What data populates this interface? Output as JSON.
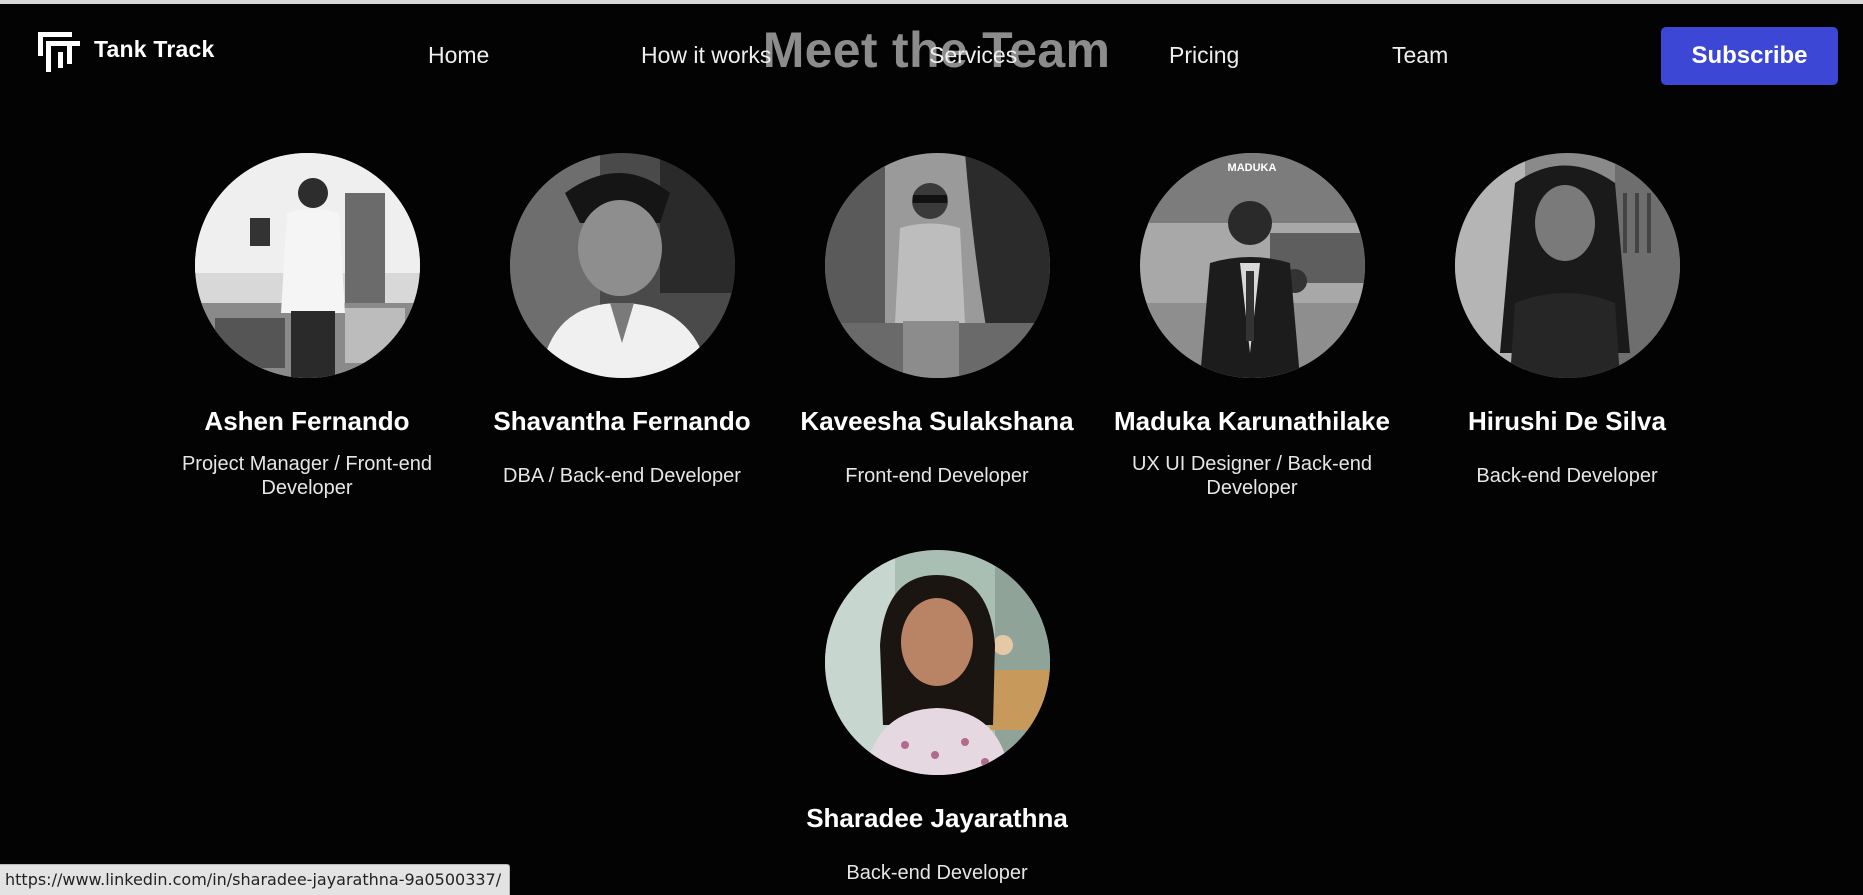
{
  "brand": {
    "name": "Tank Track",
    "logo_icon": "tank-track-logo-icon"
  },
  "page": {
    "title": "Meet the Team"
  },
  "nav": {
    "items": [
      {
        "label": "Home"
      },
      {
        "label": "How it works"
      },
      {
        "label": "Services"
      },
      {
        "label": "Pricing"
      },
      {
        "label": "Team"
      }
    ],
    "subscribe_label": "Subscribe"
  },
  "team": [
    {
      "name": "Ashen Fernando",
      "role": "Project Manager / Front-end Developer",
      "photo": "grayscale"
    },
    {
      "name": "Shavantha Fernando",
      "role": "DBA / Back-end Developer",
      "photo": "grayscale"
    },
    {
      "name": "Kaveesha Sulakshana",
      "role": "Front-end Developer",
      "photo": "grayscale"
    },
    {
      "name": "Maduka Karunathilake",
      "role": "UX UI Designer / Back-end Developer",
      "photo": "grayscale"
    },
    {
      "name": "Hirushi De Silva",
      "role": "Back-end Developer",
      "photo": "grayscale"
    },
    {
      "name": "Sharadee Jayarathna",
      "role": "Back-end Developer",
      "photo": "color"
    }
  ],
  "status_bar": {
    "url": "https://www.linkedin.com/in/sharadee-jayarathna-9a0500337/"
  },
  "colors": {
    "background": "#030304",
    "accent": "#3d47d6",
    "title": "#8c8c8c"
  }
}
